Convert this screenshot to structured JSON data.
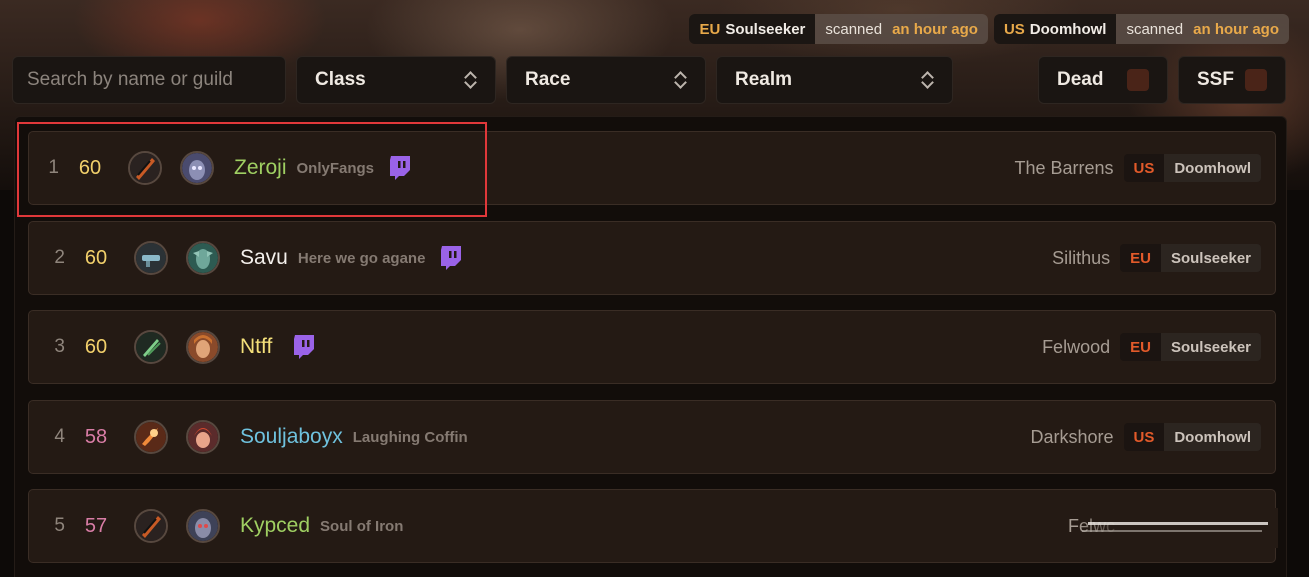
{
  "status": [
    {
      "region": "EU",
      "realm": "Soulseeker",
      "label": "scanned",
      "ago": "an hour ago"
    },
    {
      "region": "US",
      "realm": "Doomhowl",
      "label": "scanned",
      "ago": "an hour ago"
    }
  ],
  "filters": {
    "search_placeholder": "Search by name or guild",
    "class": "Class",
    "race": "Race",
    "realm": "Realm",
    "dead": "Dead",
    "ssf": "SSF"
  },
  "rows": [
    {
      "rank": "1",
      "level": "60",
      "name": "Zeroji",
      "guild": "OnlyFangs",
      "location": "The Barrens",
      "region": "US",
      "realm": "Doomhowl",
      "name_color": "#9fcf62",
      "level_color": "#f2d06b",
      "twitch": true
    },
    {
      "rank": "2",
      "level": "60",
      "name": "Savu",
      "guild": "Here we go agane",
      "location": "Silithus",
      "region": "EU",
      "realm": "Soulseeker",
      "name_color": "#f4f0ec",
      "level_color": "#f2d06b",
      "twitch": true
    },
    {
      "rank": "3",
      "level": "60",
      "name": "Ntff",
      "guild": "",
      "location": "Felwood",
      "region": "EU",
      "realm": "Soulseeker",
      "name_color": "#f4e07a",
      "level_color": "#f2d06b",
      "twitch": true
    },
    {
      "rank": "4",
      "level": "58",
      "name": "Souljaboyx",
      "guild": "Laughing Coffin",
      "location": "Darkshore",
      "region": "US",
      "realm": "Doomhowl",
      "name_color": "#6fc2de",
      "level_color": "#d97da6",
      "twitch": false
    },
    {
      "rank": "5",
      "level": "57",
      "name": "Kypced",
      "guild": "Soul of Iron",
      "location": "Felwc",
      "region": "",
      "realm": "",
      "name_color": "#9fcf62",
      "level_color": "#d97da6",
      "twitch": false
    }
  ]
}
